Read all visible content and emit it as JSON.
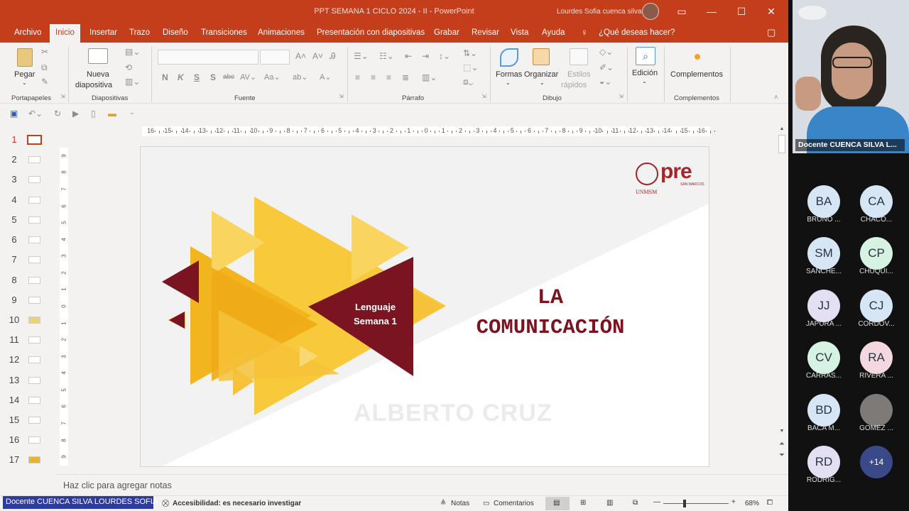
{
  "window": {
    "title": "PPT SEMANA 1 CICLO 2024 - II  -  PowerPoint",
    "user": "Lourdes Sofia cuenca silva"
  },
  "menu": {
    "tabs": [
      "Archivo",
      "Inicio",
      "Insertar",
      "Trazo",
      "Diseño",
      "Transiciones",
      "Animaciones",
      "Presentación con diapositivas",
      "Grabar",
      "Revisar",
      "Vista",
      "Ayuda"
    ],
    "active": "Inicio",
    "tell_me": "¿Qué deseas hacer?"
  },
  "ribbon": {
    "pegar": "Pegar",
    "nueva_diapositiva_1": "Nueva",
    "nueva_diapositiva_2": "diapositiva",
    "formas": "Formas",
    "organizar": "Organizar",
    "estilos_1": "Estilos",
    "estilos_2": "rápidos",
    "edicion": "Edición",
    "complementos": "Complementos",
    "font_buttons": [
      "N",
      "K",
      "S",
      "S",
      "abc"
    ],
    "groups": {
      "portapapeles": "Portapapeles",
      "diapositivas": "Diapositivas",
      "fuente": "Fuente",
      "parrafo": "Párrafo",
      "dibujo": "Dibujo",
      "complementos": "Complementos"
    }
  },
  "ruler": {
    "ticks": [
      "16",
      "15",
      "14",
      "13",
      "12",
      "11",
      "10",
      "9",
      "8",
      "7",
      "6",
      "5",
      "4",
      "3",
      "2",
      "1",
      "0",
      "1",
      "2",
      "3",
      "4",
      "5",
      "6",
      "7",
      "8",
      "9",
      "10",
      "11",
      "12",
      "13",
      "14",
      "15",
      "16"
    ],
    "vticks": [
      "9",
      "8",
      "7",
      "6",
      "5",
      "4",
      "3",
      "2",
      "1",
      "0",
      "1",
      "2",
      "3",
      "4",
      "5",
      "6",
      "7",
      "8",
      "9"
    ]
  },
  "thumbnails": [
    "1",
    "2",
    "3",
    "4",
    "5",
    "6",
    "7",
    "8",
    "9",
    "10",
    "11",
    "12",
    "13",
    "14",
    "15",
    "16",
    "17"
  ],
  "slide": {
    "tag_line1": "Lenguaje",
    "tag_line2": "Semana 1",
    "title_line1": "LA",
    "title_line2": "COMUNICACIÓN",
    "watermark": "ALBERTO CRUZ",
    "logo_text": "pre",
    "logo_sub": "SAN MARCOS",
    "logo_unmsm": "UNMSM",
    "colors": {
      "maroon": "#7a1420",
      "gold": "#f2b81e",
      "yellow": "#f8cc3a",
      "title": "#7a1420"
    }
  },
  "notes": {
    "placeholder": "Haz clic para agregar notas"
  },
  "status": {
    "presenter_tag": "Docente CUENCA SILVA LOURDES SOFIA",
    "accessibility": "Accesibilidad: es necesario investigar",
    "notas": "Notas",
    "comentarios": "Comentarios",
    "zoom": "68%"
  },
  "meeting": {
    "video_label": "Docente CUENCA SILVA L...",
    "participants": [
      {
        "initials": "BA",
        "name": "BRUNO ...",
        "color": "#d6e6f4"
      },
      {
        "initials": "CA",
        "name": "CHACO...",
        "color": "#d6e6f4"
      },
      {
        "initials": "SM",
        "name": "SANCHE...",
        "color": "#d6e6f4"
      },
      {
        "initials": "CP",
        "name": "CHUQUI...",
        "color": "#d6f2e2"
      },
      {
        "initials": "JJ",
        "name": "JAPURA ...",
        "color": "#e4e0f4"
      },
      {
        "initials": "CJ",
        "name": "CORDOV...",
        "color": "#d6e6f4"
      },
      {
        "initials": "CV",
        "name": "CARRAS...",
        "color": "#d6f2e2"
      },
      {
        "initials": "RA",
        "name": "RIVERA ...",
        "color": "#f4d8e0"
      },
      {
        "initials": "BD",
        "name": "BACA M...",
        "color": "#d6e6f4"
      },
      {
        "initials": "",
        "name": "GOMEZ ...",
        "color": "#7d7a78"
      },
      {
        "initials": "RD",
        "name": "RODRIG...",
        "color": "#e4e0f4"
      },
      {
        "initials": "+14",
        "name": "",
        "color": "#3a4a88"
      }
    ]
  }
}
